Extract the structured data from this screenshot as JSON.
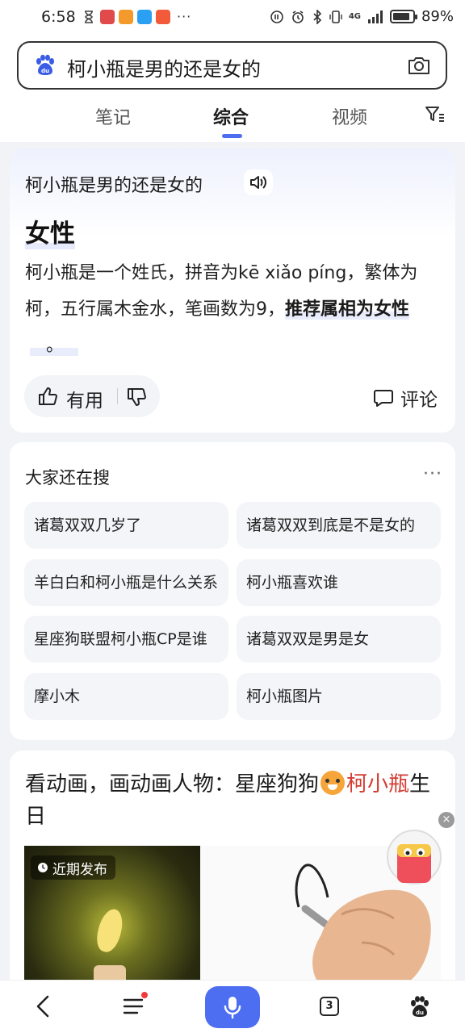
{
  "status_bar": {
    "time": "6:58",
    "more": "···",
    "network": "4G",
    "battery_percent": "89%",
    "battery_level": 0.89
  },
  "search": {
    "query": "柯小瓶是男的还是女的"
  },
  "tabs": [
    {
      "label": "笔记",
      "active": false
    },
    {
      "label": "综合",
      "active": true
    },
    {
      "label": "视频",
      "active": false
    }
  ],
  "answer": {
    "question": "柯小瓶是男的还是女的",
    "title": "女性",
    "body_plain": "柯小瓶是一个姓氏，拼音为kē xiǎo píng，繁体为柯，五行属木金水，笔画数为9，",
    "body_bold": "推荐属相为女性",
    "body_end": "。",
    "useful_label": "有用",
    "comment_label": "评论"
  },
  "related": {
    "title": "大家还在搜",
    "more": "···",
    "items": [
      "诸葛双双几岁了",
      "诸葛双双到底是不是女的",
      "羊白白和柯小瓶是什么关系",
      "柯小瓶喜欢谁",
      "星座狗联盟柯小瓶CP是谁",
      "诸葛双双是男是女",
      "摩小木",
      "柯小瓶图片"
    ]
  },
  "video": {
    "title_part1": "看动画，画动画人物：星座狗狗",
    "title_highlight": "柯小瓶",
    "title_part2": "生日",
    "badge": "近期发布"
  },
  "float": {
    "close": "×"
  },
  "bottom_nav": {
    "tab_count": "3"
  },
  "colors": {
    "accent": "#4e6ef2",
    "highlight_red": "#d33a31",
    "background": "#f2f3f7"
  }
}
